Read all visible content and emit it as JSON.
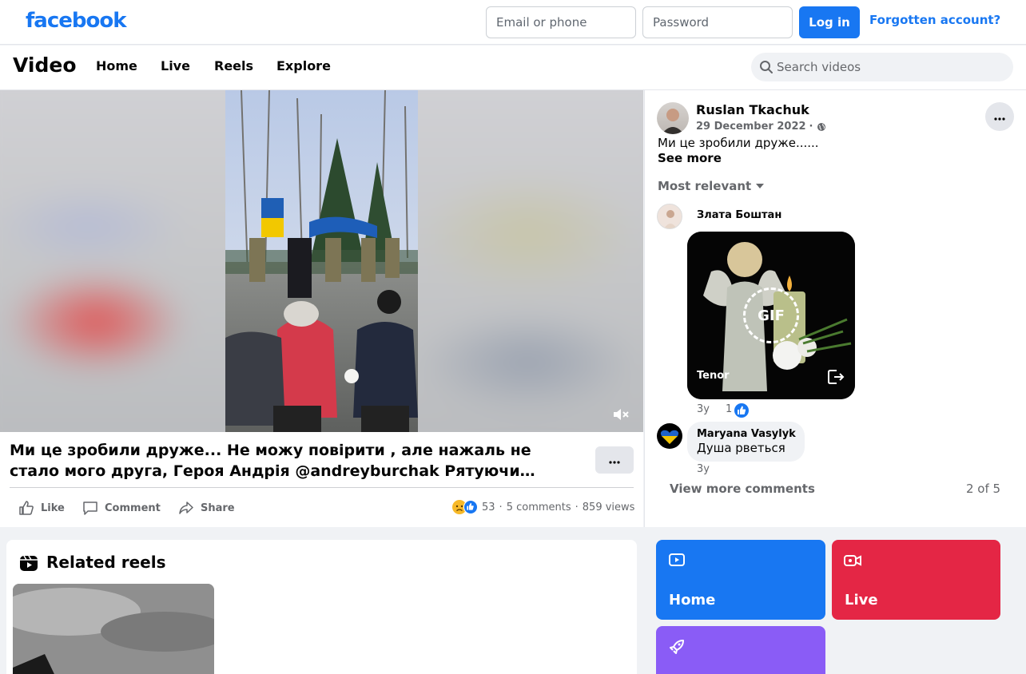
{
  "topbar": {
    "logo": "facebook",
    "email_placeholder": "Email or phone",
    "password_placeholder": "Password",
    "login_label": "Log in",
    "forgot_label": "Forgotten account?"
  },
  "video_header": {
    "title": "Video",
    "nav": [
      "Home",
      "Live",
      "Reels",
      "Explore"
    ],
    "search_placeholder": "Search videos"
  },
  "post": {
    "caption": "Ми це зробили друже... Не можу повірити , але нажаль не стало мого друга, Героя Андрія @andreyburchak Рятуючи…",
    "actions": {
      "like": "Like",
      "comment": "Comment",
      "share": "Share"
    },
    "stats": {
      "reactions": "53",
      "comments": "5 comments",
      "views": "859 views",
      "sep": "·"
    }
  },
  "comments_panel": {
    "author": "Ruslan Tkachuk",
    "date": "29 December 2022",
    "date_sep": "·",
    "text": "Ми це зробили друже......",
    "see_more": "See more",
    "sort_label": "Most relevant",
    "comments": [
      {
        "name": "Злата Боштан",
        "gif_label": "GIF",
        "gif_source": "Tenor",
        "time": "3y",
        "likes": "1"
      },
      {
        "name": "Maryana Vasylyk",
        "text": "Душа рветься",
        "time": "3y"
      }
    ],
    "view_more": "View more comments",
    "count": "2 of 5"
  },
  "related": {
    "title": "Related reels"
  },
  "tiles": [
    {
      "label": "Home",
      "color": "#1877f2"
    },
    {
      "label": "Live",
      "color": "#e42645"
    },
    {
      "label": "",
      "color": "#8a5cf6"
    }
  ]
}
